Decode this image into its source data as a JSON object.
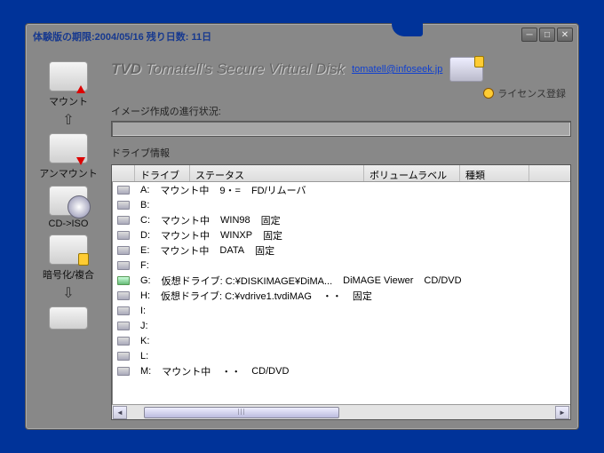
{
  "titlebar": {
    "trial_text": "体験版の期限:2004/05/16 残り日数: 11日"
  },
  "header": {
    "tvd": "TVD",
    "title": "Tomatell's Secure Virtual Disk",
    "email": "tomatell@infoseek.jp",
    "license": "ライセンス登録"
  },
  "labels": {
    "progress": "イメージ作成の進行状況:",
    "drive_info": "ドライブ情報"
  },
  "sidebar": {
    "items": [
      {
        "label": "マウント",
        "icon": "drive-up"
      },
      {
        "label": "アンマウント",
        "icon": "drive-down"
      },
      {
        "label": "CD->ISO",
        "icon": "cd"
      },
      {
        "label": "暗号化/複合",
        "icon": "lock"
      },
      {
        "label": "",
        "icon": "misc"
      }
    ]
  },
  "columns": {
    "c0": "",
    "c1": "ドライブ",
    "c2": "ステータス",
    "c3": "ボリュームラベル",
    "c4": "種類"
  },
  "drives": [
    {
      "letter": "A:",
      "status": "マウント中",
      "volume": "9・=",
      "type": "FD/リムーバ",
      "green": false
    },
    {
      "letter": "B:",
      "status": "",
      "volume": "",
      "type": "",
      "green": false
    },
    {
      "letter": "C:",
      "status": "マウント中",
      "volume": "WIN98",
      "type": "固定",
      "green": false
    },
    {
      "letter": "D:",
      "status": "マウント中",
      "volume": "WINXP",
      "type": "固定",
      "green": false
    },
    {
      "letter": "E:",
      "status": "マウント中",
      "volume": "DATA",
      "type": "固定",
      "green": false
    },
    {
      "letter": "F:",
      "status": "",
      "volume": "",
      "type": "",
      "green": false
    },
    {
      "letter": "G:",
      "status": "仮想ドライブ: C:¥DISKIMAGE¥DiMA...",
      "volume": "DiMAGE Viewer",
      "type": "CD/DVD",
      "green": true
    },
    {
      "letter": "H:",
      "status": "仮想ドライブ: C:¥vdrive1.tvdiMAG",
      "volume": "・・",
      "type": "固定",
      "green": false
    },
    {
      "letter": "I:",
      "status": "",
      "volume": "",
      "type": "",
      "green": false
    },
    {
      "letter": "J:",
      "status": "",
      "volume": "",
      "type": "",
      "green": false
    },
    {
      "letter": "K:",
      "status": "",
      "volume": "",
      "type": "",
      "green": false
    },
    {
      "letter": "L:",
      "status": "",
      "volume": "",
      "type": "",
      "green": false
    },
    {
      "letter": "M:",
      "status": "マウント中",
      "volume": "・・",
      "type": "CD/DVD",
      "green": false
    }
  ]
}
